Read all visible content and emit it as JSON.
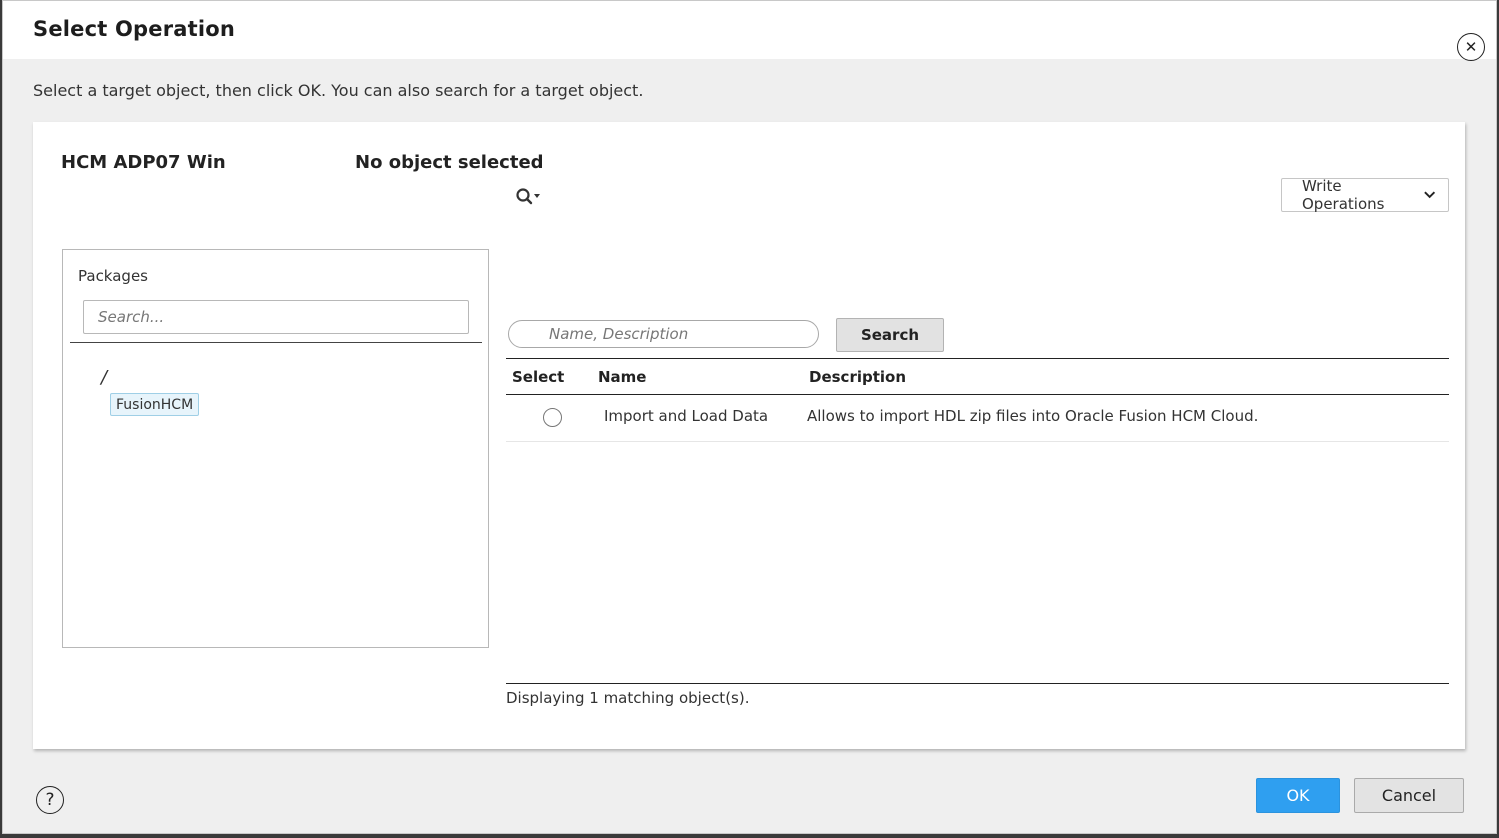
{
  "dialog": {
    "title": "Select Operation",
    "close_icon": "close-icon",
    "instructions": "Select a target object, then click OK. You can also search for a target object."
  },
  "panel": {
    "connection_name": "HCM ADP07 Win",
    "selected_object": "No object selected",
    "search_toggle_icon": "search-icon",
    "operations_dropdown": {
      "selected": "Write Operations",
      "icon": "chevron-down-icon"
    },
    "packages": {
      "label": "Packages",
      "search_placeholder": "Search...",
      "tree_root": "/",
      "tree_items": [
        "FusionHCM"
      ]
    },
    "search": {
      "placeholder": "Name, Description",
      "button_label": "Search"
    },
    "table": {
      "columns": [
        "Select",
        "Name",
        "Description"
      ],
      "rows": [
        {
          "name": "Import and Load Data",
          "description": "Allows to import HDL zip files into Oracle Fusion HCM Cloud."
        }
      ]
    },
    "status": "Displaying 1 matching object(s)."
  },
  "footer": {
    "help_icon": "help-icon",
    "help_label": "?",
    "ok_label": "OK",
    "cancel_label": "Cancel"
  },
  "colors": {
    "accent": "#2f9ff0",
    "selected_item_bg": "#e7f4fb",
    "selected_item_border": "#9fcfe6"
  }
}
